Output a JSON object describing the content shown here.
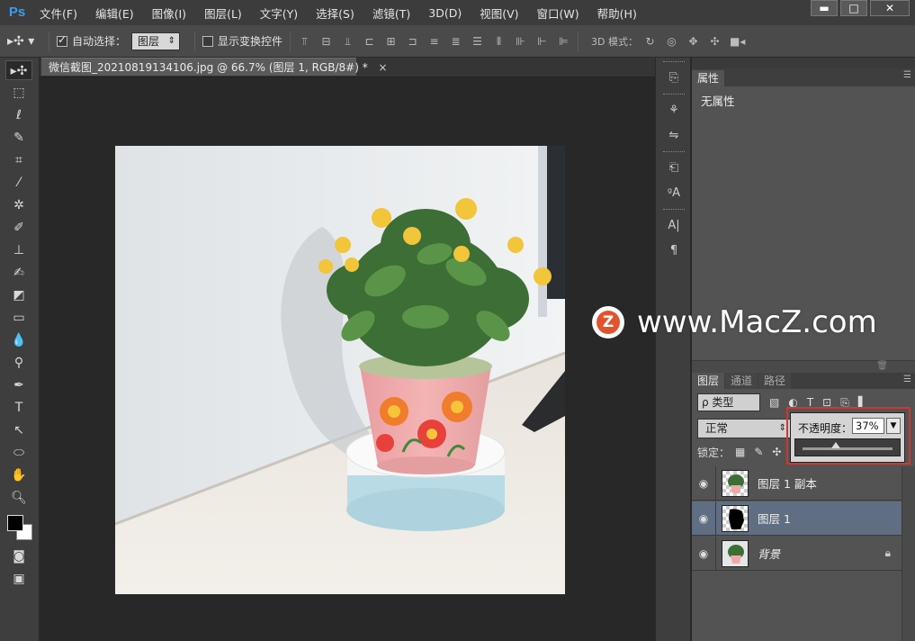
{
  "app": {
    "logo_text": "Ps",
    "menu": [
      "文件(F)",
      "编辑(E)",
      "图像(I)",
      "图层(L)",
      "文字(Y)",
      "选择(S)",
      "滤镜(T)",
      "3D(D)",
      "视图(V)",
      "窗口(W)",
      "帮助(H)"
    ],
    "window_buttons": {
      "minimize": "▬",
      "maximize": "□",
      "close": "✕"
    }
  },
  "options_bar": {
    "auto_select_label": "自动选择：",
    "auto_select_checked": true,
    "auto_select_target": "图层",
    "show_transform_label": "显示变换控件",
    "show_transform_checked": false,
    "mode_3d_label": "3D 模式："
  },
  "document": {
    "tab_title": "微信截图_20210819134106.jpg @ 66.7% (图层 1, RGB/8#) *",
    "tab_close": "×"
  },
  "properties_panel": {
    "tab_label": "属性",
    "content": "无属性"
  },
  "layers_panel": {
    "tabs": [
      "图层",
      "通道",
      "路径"
    ],
    "filter_type": "ρ 类型",
    "blend_mode": "正常",
    "lock_label": "锁定：",
    "opacity_label": "不透明度：",
    "opacity_value": "37%",
    "opacity_percent": 37,
    "layers": [
      {
        "name": "图层 1 副本",
        "selected": false,
        "visible": true
      },
      {
        "name": "图层 1",
        "selected": true,
        "visible": true
      },
      {
        "name": "背景",
        "selected": false,
        "visible": true,
        "locked": true
      }
    ]
  },
  "watermark": {
    "logo_letter": "Z",
    "text": "www.MacZ.com"
  },
  "colors": {
    "accent_highlight": "#d8332c",
    "ps_logo": "#3a9cf5",
    "selected_layer": "#5f6e82"
  }
}
